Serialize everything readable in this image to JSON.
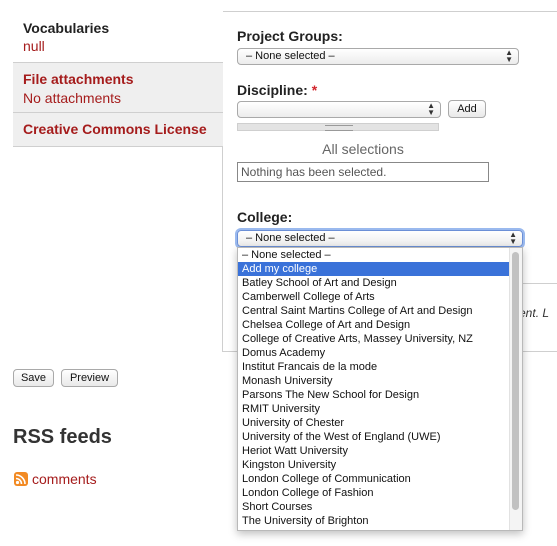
{
  "tabs": [
    {
      "title": "Vocabularies",
      "summary": "null"
    },
    {
      "title": "File attachments",
      "summary": "No attachments"
    },
    {
      "title": "Creative Commons License",
      "summary": ""
    }
  ],
  "project_groups": {
    "label": "Project Groups:",
    "selected": "– None selected –"
  },
  "discipline": {
    "label": "Discipline:",
    "required_mark": "*",
    "selected": "",
    "add_label": "Add"
  },
  "all_selections": {
    "label": "All selections",
    "empty_text": "Nothing has been selected."
  },
  "college": {
    "label": "College:",
    "selected": "– None selected –",
    "highlighted_index": 1,
    "options": [
      "– None selected –",
      "Add my college",
      "Batley School of Art and Design",
      "Camberwell College of Arts",
      "Central Saint Martins College of Art and Design",
      "Chelsea College of Art and Design",
      "College of Creative Arts, Massey University, NZ",
      "Domus Academy",
      "Institut Francais de la mode",
      "Monash University",
      "Parsons The New School for Design",
      "RMIT University",
      "University of Chester",
      "University of the West of England (UWE)",
      "Heriot Watt University",
      "Kingston University",
      "London College of Communication",
      "London College of Fashion",
      "Short Courses",
      "The University of Brighton"
    ]
  },
  "partial_text": "ntent. L",
  "actions": {
    "save": "Save",
    "preview": "Preview"
  },
  "rss": {
    "title": "RSS feeds",
    "link": "comments",
    "icon": "rss-feed-icon"
  },
  "colors": {
    "accent": "#a51c1c",
    "required": "#d2252c",
    "highlight": "#3a72d9",
    "feed": "#f28a23"
  }
}
